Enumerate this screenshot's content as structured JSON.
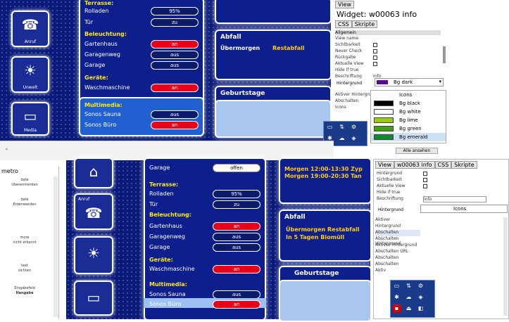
{
  "top": {
    "tiles": [
      {
        "label": "Anruf",
        "icon": "telephone-icon"
      },
      {
        "label": "Unwelt",
        "icon": "solar-panel-icon"
      },
      {
        "label": "Media",
        "icon": "tv-icon"
      }
    ],
    "list": {
      "sections": {
        "terrasse": "Terrasse:",
        "beleuchtung": "Beleuchtung:",
        "geraete": "Geräte:",
        "multimedia": "Multimedia:"
      },
      "rows": {
        "rolladen": {
          "label": "Rolladen",
          "value": "95%"
        },
        "tuer": {
          "label": "Tür",
          "value": "zu"
        },
        "gartenhaus": {
          "label": "Gartenhaus",
          "value": "an"
        },
        "garagenweg": {
          "label": "Garagenweg",
          "value": "aus"
        },
        "garage": {
          "label": "Garage",
          "value": "aus"
        },
        "waschmaschine": {
          "label": "Waschmaschine",
          "value": "an"
        },
        "sauna": {
          "label": "Sonos Sauna",
          "value": "aus"
        },
        "buero": {
          "label": "Sonos Büro",
          "value": "an"
        }
      }
    },
    "abfall": {
      "title": "Abfall",
      "line1": "Übermorgen",
      "line1_val": "Restabfall"
    },
    "geburtstage": {
      "title": "Geburtstage"
    },
    "editor": {
      "view_tab": "View",
      "widget_title": "Widget: w00063 info",
      "tabs": [
        "CSS",
        "Skripte"
      ],
      "section": "Allgemein",
      "fields": [
        "View name",
        "Sichtbarkeit",
        "Never Check",
        "Rückgabe",
        "Aktuelle View",
        "Hide if true",
        "Beschriftung"
      ],
      "beschriftung_value": "info",
      "hintergrund_label": "Hintergrund",
      "hintergrund_value": "Bg dark",
      "more_fields": [
        "Aktiver Hintergrund",
        "Abschalten",
        "Icons"
      ],
      "menu": [
        {
          "label": "Icons",
          "color": "#ffffff"
        },
        {
          "label": "Bg black",
          "color": "#000000"
        },
        {
          "label": "Bg white",
          "color": "#ffffff"
        },
        {
          "label": "Bg lime",
          "color": "#9bcb0c"
        },
        {
          "label": "Bg green",
          "color": "#40a010"
        },
        {
          "label": "Bg emerald",
          "color": "#0d8b2a"
        }
      ],
      "footer_btn": "Alle ansehen"
    }
  },
  "bottom": {
    "sidebar": {
      "title": "metro",
      "items": [
        "date",
        "Uberenmerden",
        "date",
        "Erdenwerden",
        "more",
        "nicht erkannt",
        "text",
        "sichten",
        "Eingabefeld",
        "Hangabe"
      ]
    },
    "list": {
      "rows": {
        "garage_top": {
          "label": "Garage",
          "value": "offen"
        },
        "terrasse": "Terrasse:",
        "rolladen": {
          "label": "Rolladen",
          "value": "95%"
        },
        "tuer": {
          "label": "Tür",
          "value": "zu"
        },
        "beleuchtung": "Beleuchtung:",
        "gartenhaus": {
          "label": "Gartenhaus",
          "value": "an"
        },
        "garagenweg": {
          "label": "Garagenweg",
          "value": "aus"
        },
        "garage": {
          "label": "Garage",
          "value": "aus"
        },
        "geraete": "Geräte:",
        "waschmaschine": {
          "label": "Waschmaschine",
          "value": "an"
        },
        "multimedia": "Multimedia:",
        "sauna": {
          "label": "Sonos Sauna",
          "value": "aus"
        },
        "buero": {
          "label": "Sonos Büro",
          "value": "an"
        }
      }
    },
    "termine": {
      "line1": "Morgen 12:00-13:30 Zyp",
      "line2": "Morgen 19:00-20:30 Tan"
    },
    "abfall": {
      "title": "Abfall",
      "line1": "Übermorgen Restabfall",
      "line2": "In 5 Tagen Biomüll"
    },
    "geburtstage": {
      "title": "Geburtstage"
    },
    "tile_label": "Anruf",
    "editor": {
      "tabs": [
        "View",
        "w00063 info",
        "CSS",
        "Skripte"
      ],
      "fields": [
        "Hintergrund",
        "Sichtbarkeit",
        "Aktuelle View",
        "Hide if true",
        "Beschriftung"
      ],
      "beschriftung_value": "info",
      "hintergrund_label": "Hintergrund",
      "hintergrund_value": "Icons",
      "list_items": [
        "Aktiver",
        "Hintergrund",
        "Abschalten",
        "Abschalten Hintergrund",
        "Aktiver Hintergrund",
        "Abschalten URL",
        "Abschalten",
        "Abschalten",
        "Aktiv"
      ]
    }
  }
}
